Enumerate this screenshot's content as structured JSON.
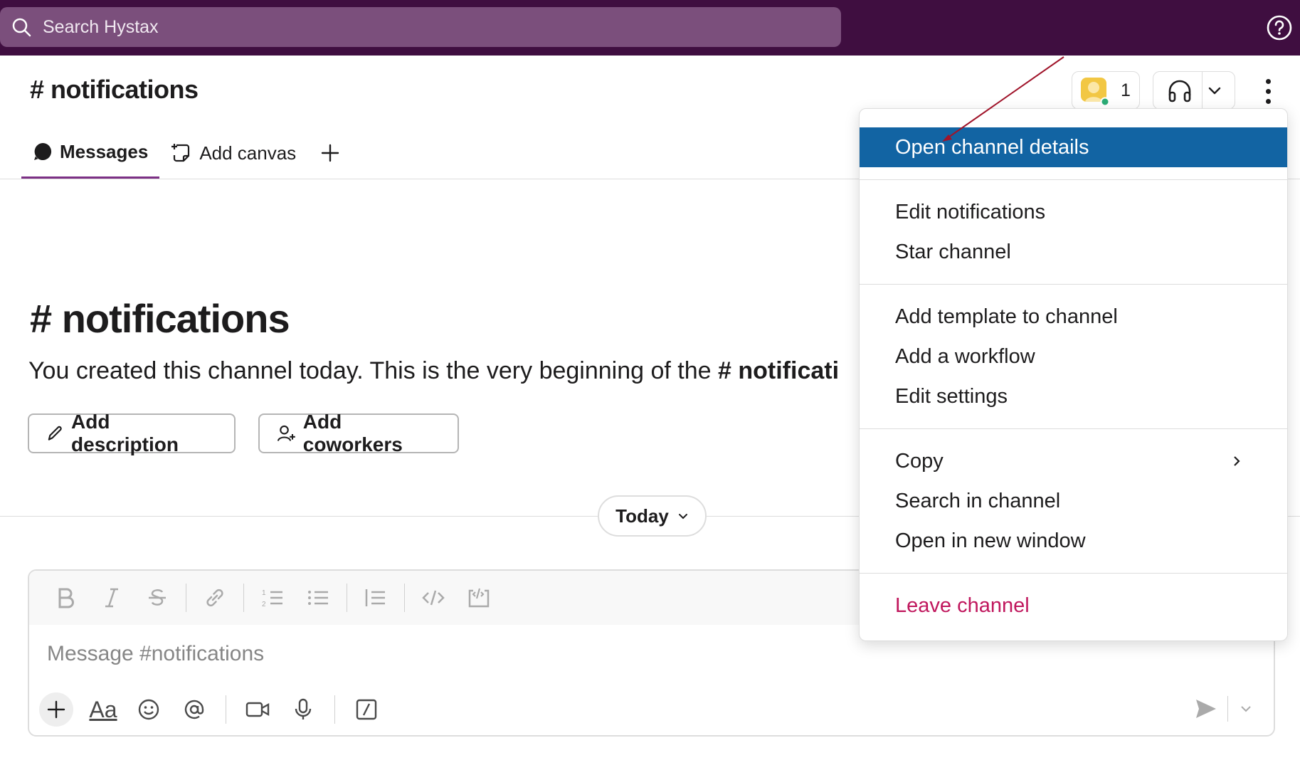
{
  "topbar": {
    "search_placeholder": "Search Hystax"
  },
  "channel": {
    "title": "# notifications",
    "member_count": "1"
  },
  "tabs": [
    {
      "label": "Messages"
    },
    {
      "label": "Add canvas"
    }
  ],
  "intro": {
    "title": "# notifications",
    "text": "You created this channel today. This is the very beginning of the",
    "channel_ref": "# notificati",
    "add_description": "Add description",
    "add_coworkers": "Add coworkers"
  },
  "date_divider": {
    "label": "Today"
  },
  "composer": {
    "placeholder": "Message #notifications",
    "format_label": "Aa"
  },
  "menu": {
    "items": [
      {
        "label": "Open channel details"
      },
      {
        "label": "Edit notifications"
      },
      {
        "label": "Star channel"
      },
      {
        "label": "Add template to channel"
      },
      {
        "label": "Add a workflow"
      },
      {
        "label": "Edit settings"
      },
      {
        "label": "Copy"
      },
      {
        "label": "Search in channel"
      },
      {
        "label": "Open in new window"
      },
      {
        "label": "Leave channel"
      }
    ]
  },
  "colors": {
    "topbar": "#3f0e40",
    "search": "#7b4f7c",
    "tab_underline": "#7c3085",
    "menu_highlight": "#1264a3",
    "danger": "#c0175d",
    "annotation_arrow": "#a0142a"
  }
}
